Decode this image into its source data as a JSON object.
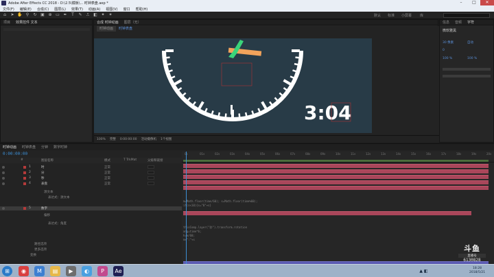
{
  "window": {
    "title": "Adobe After Effects CC 2018 - D:\\2.5\\模板\\... 时钟表盘.aep *"
  },
  "menu": [
    "文件(F)",
    "编辑(E)",
    "合成(C)",
    "图层(L)",
    "效果(T)",
    "动画(A)",
    "视图(V)",
    "窗口",
    "帮助(H)"
  ],
  "toolbar": {
    "workspaces": [
      "默认",
      "标准",
      "小屏幕",
      "库"
    ],
    "search_placeholder": ""
  },
  "project_panel": {
    "tabs": [
      "项目",
      "效果控件 文本"
    ]
  },
  "viewer": {
    "tabs": [
      "合成 时钟动画",
      "图层（无）"
    ],
    "subtabs": [
      "时钟动画",
      "时钟表盘"
    ],
    "clock_text": "3:04",
    "footer": [
      "100%",
      "完整",
      "0:00:00:00",
      "活动摄像机",
      "1个视图"
    ]
  },
  "right_panel": {
    "tabs": [
      "信息",
      "音频",
      "预览",
      "字符",
      "段落"
    ],
    "font_name": "微软雅黑",
    "values": [
      "30 像素",
      "自动",
      "0",
      "100 %",
      "100 %"
    ]
  },
  "timeline": {
    "tabs": [
      "时钟动画",
      "时钟表盘",
      "分钟",
      "数字时钟"
    ],
    "timecode": "0:00:00:00",
    "columns": [
      "#",
      "图层名称",
      "模式",
      "T TrkMat",
      "父级和链接"
    ],
    "layers": [
      {
        "num": "1",
        "name": "时",
        "mode": "正常"
      },
      {
        "num": "2",
        "name": "分",
        "mode": "正常"
      },
      {
        "num": "3",
        "name": "秒",
        "mode": "正常"
      },
      {
        "num": "4",
        "name": "表盘",
        "mode": "正常"
      },
      {
        "num": "5",
        "name": "数字",
        "mode": "正常"
      }
    ],
    "sub_items": [
      "源文本",
      "表达式：源文本",
      "偏移",
      "表达式：角度",
      "路径选项",
      "更多选项",
      "变换"
    ],
    "ruler_labels": [
      "0s",
      "01s",
      "02s",
      "03s",
      "04s",
      "05s",
      "06s",
      "07s",
      "08s",
      "09s",
      "10s",
      "11s",
      "12s",
      "13s",
      "14s",
      "15s",
      "16s",
      "17s",
      "18s",
      "19s",
      "20s"
    ],
    "code_lines": [
      "m=Math.floor(time/60); s=Math.floor(time%60);",
      "if(s<10){s=\"0\"+s}",
      "thisComp.layer(\"秒\").transform.rotation",
      "ang=time*6;",
      "h=m/60;",
      "m+\":\"+s"
    ]
  },
  "watermark": {
    "logo": "斗鱼",
    "sub": "直播号",
    "id": "6130828"
  },
  "taskbar": {
    "time": "18:28",
    "date": "2018/5/21"
  }
}
